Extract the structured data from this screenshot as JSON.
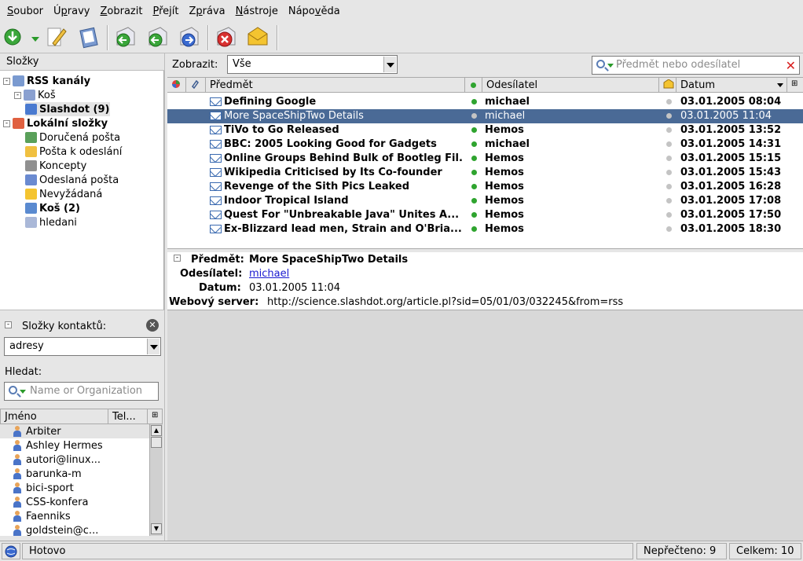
{
  "menu": [
    {
      "label": "Soubor",
      "u": "S"
    },
    {
      "label": "Úpravy",
      "u": "p"
    },
    {
      "label": "Zobrazit",
      "u": "Z"
    },
    {
      "label": "Přejít",
      "u": "P"
    },
    {
      "label": "Zpráva",
      "u": "p"
    },
    {
      "label": "Nástroje",
      "u": "N"
    },
    {
      "label": "Nápověda",
      "u": "v"
    }
  ],
  "toolbar": {
    "icons": [
      "get-mail-icon",
      "compose-icon",
      "address-book-icon",
      "reply-icon",
      "reply-all-icon",
      "forward-icon",
      "delete-icon",
      "junk-icon"
    ]
  },
  "folders": {
    "title": "Složky",
    "items": [
      {
        "label": "RSS kanály",
        "bold": true
      },
      {
        "label": "Koš"
      },
      {
        "label": "Slashdot (9)",
        "bold": true
      },
      {
        "label": "Lokální složky",
        "bold": true
      },
      {
        "label": "Doručená pošta"
      },
      {
        "label": "Pošta k odeslání"
      },
      {
        "label": "Koncepty"
      },
      {
        "label": "Odeslaná pošta"
      },
      {
        "label": "Nevyžádaná"
      },
      {
        "label": "Koš (2)",
        "bold": true
      },
      {
        "label": "hledani"
      }
    ]
  },
  "contacts": {
    "title": "Složky kontaktů:",
    "book": "adresy",
    "search_label": "Hledat:",
    "search_placeholder": "Name or Organization",
    "col_name": "Jméno",
    "col_tel": "Tel...",
    "items": [
      "Arbiter",
      "Ashley Hermes",
      "autori@linux...",
      "barunka-m",
      "bici-sport",
      "CSS-konfera",
      "Faenniks",
      "goldstein@c..."
    ]
  },
  "filter": {
    "label": "Zobrazit:",
    "value": "Vše",
    "search_placeholder": "Předmět nebo odesílatel"
  },
  "columns": {
    "subject": "Předmět",
    "sender": "Odesílatel",
    "date": "Datum"
  },
  "messages": [
    {
      "subject": "Defining Google",
      "sender": "michael",
      "date": "03.01.2005 08:04"
    },
    {
      "subject": "More SpaceShipTwo Details",
      "sender": "michael",
      "date": "03.01.2005 11:04",
      "selected": true
    },
    {
      "subject": "TiVo to Go Released",
      "sender": "Hemos",
      "date": "03.01.2005 13:52"
    },
    {
      "subject": "BBC:  2005 Looking Good for Gadgets",
      "sender": "michael",
      "date": "03.01.2005 14:31"
    },
    {
      "subject": "Online Groups Behind Bulk of Bootleg Fil...",
      "sender": "Hemos",
      "date": "03.01.2005 15:15"
    },
    {
      "subject": "Wikipedia Criticised by Its Co-founder",
      "sender": "Hemos",
      "date": "03.01.2005 15:43"
    },
    {
      "subject": "Revenge of the Sith Pics Leaked",
      "sender": "Hemos",
      "date": "03.01.2005 16:28"
    },
    {
      "subject": "Indoor Tropical Island",
      "sender": "Hemos",
      "date": "03.01.2005 17:08"
    },
    {
      "subject": "Quest For \"Unbreakable Java\" Unites A...",
      "sender": "Hemos",
      "date": "03.01.2005 17:50"
    },
    {
      "subject": "Ex-Blizzard lead men, Strain and O'Bria...",
      "sender": "Hemos",
      "date": "03.01.2005 18:30"
    }
  ],
  "preview": {
    "subject_label": "Předmět:",
    "subject": "More SpaceShipTwo Details",
    "sender_label": "Odesílatel:",
    "sender": "michael",
    "date_label": "Datum:",
    "date": "03.01.2005 11:04",
    "web_label": "Webový server:",
    "web": "http://science.slashdot.org/article.pl?sid=05/01/03/032245&from=rss"
  },
  "status": {
    "text": "Hotovo",
    "unread": "Nepřečteno: 9",
    "total": "Celkem: 10"
  }
}
